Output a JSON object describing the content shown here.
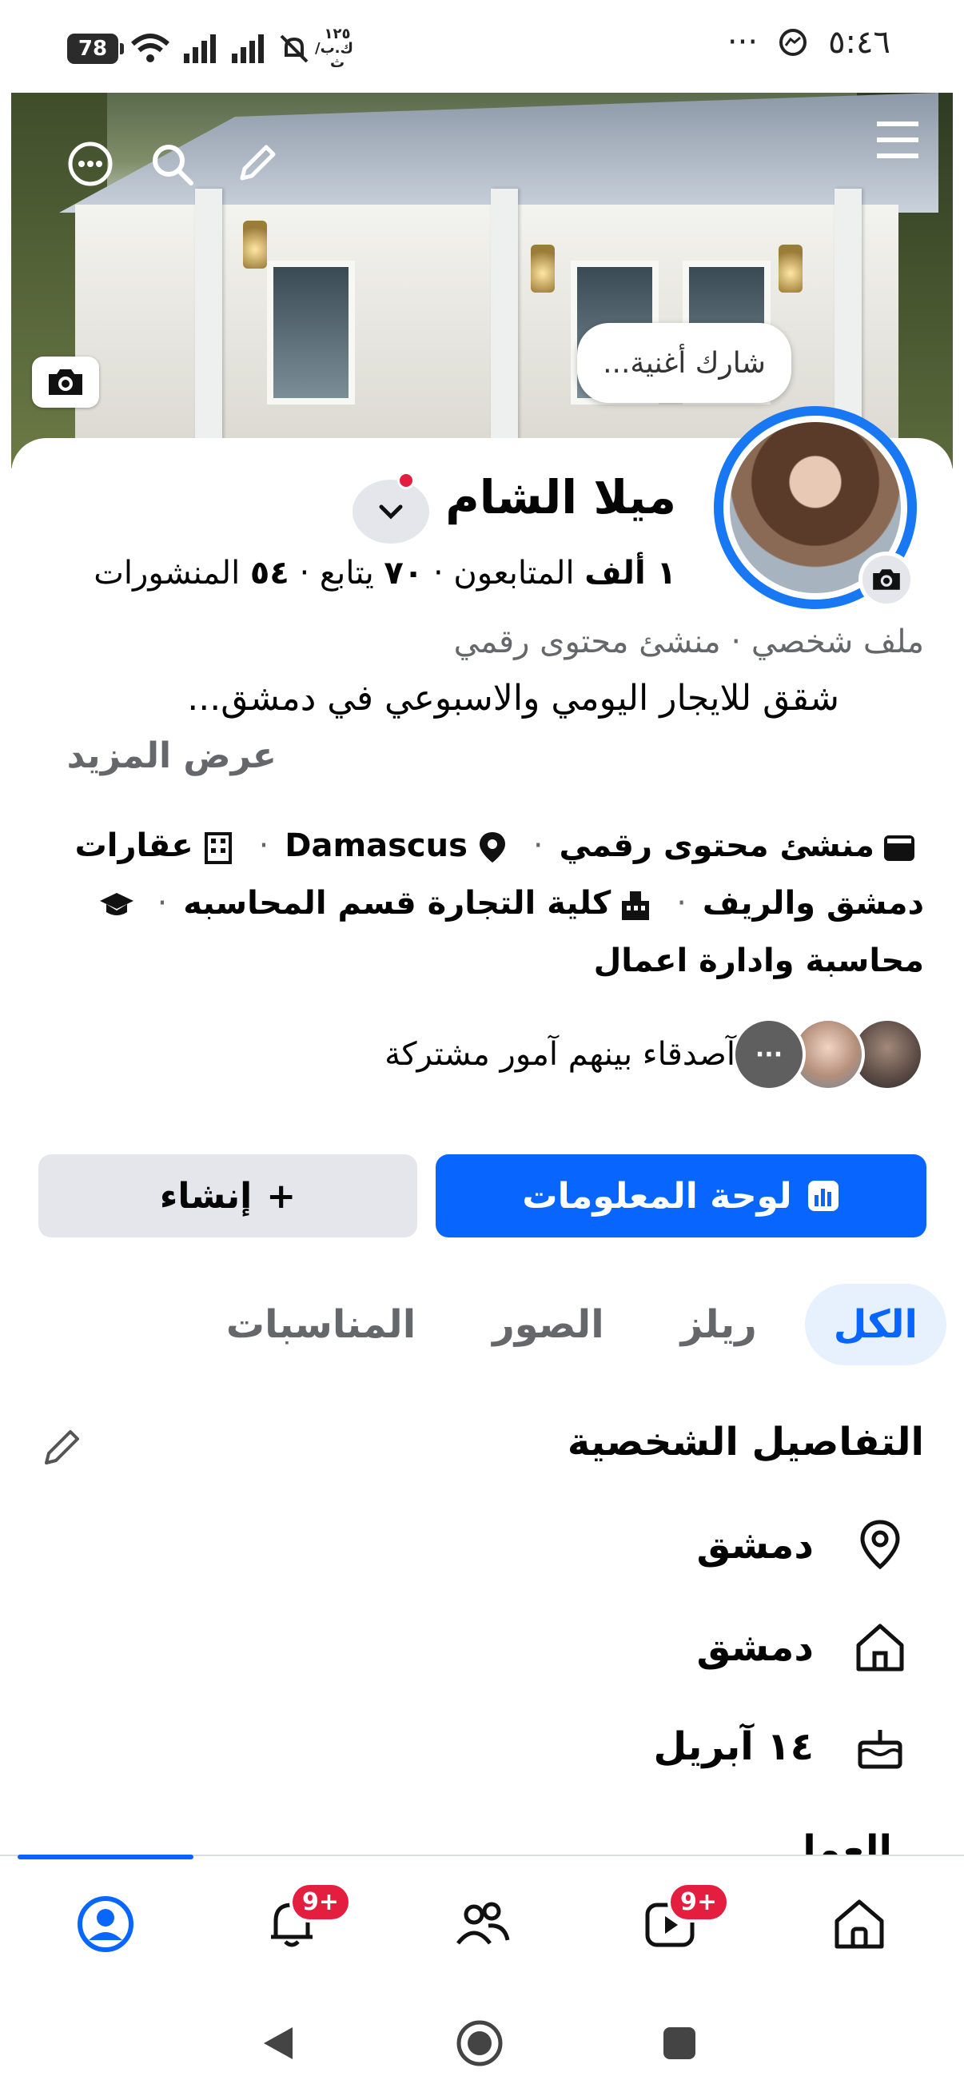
{
  "status_bar": {
    "time": "٥:٤٦",
    "dots": "···",
    "battery": "78",
    "network_speed": "١٢٥\nك.ب/ث"
  },
  "cover": {
    "song_prompt": "شارك أغنية..."
  },
  "profile": {
    "name": "ميلا الشام",
    "stats": {
      "followers_count": "١ ألف",
      "followers_label": "المتابعون",
      "following_count": "٧٠",
      "following_label": "يتابع",
      "posts_count": "٥٤",
      "posts_label": "المنشورات",
      "separator": "·"
    },
    "category": "ملف شخصي · منشئ محتوى رقمي",
    "bio": "شقق للايجار اليومي والاسبوعي في دمشق...",
    "see_more": "عرض المزيد",
    "details": {
      "creator": "منشئ محتوى رقمي",
      "city": "Damascus",
      "work": "عقارات دمشق والريف",
      "school": "كلية التجارة قسم المحاسبه",
      "study": "محاسبة وادارة اعمال"
    },
    "mutual_friends": "آصدقاء بينهم آمور مشتركة",
    "mutual_more": "···"
  },
  "actions": {
    "dashboard": "لوحة المعلومات",
    "create": "إنشاء",
    "create_prefix": "+"
  },
  "tabs": [
    {
      "label": "الكل",
      "active": true
    },
    {
      "label": "ريلز",
      "active": false
    },
    {
      "label": "الصور",
      "active": false
    },
    {
      "label": "المناسبات",
      "active": false
    }
  ],
  "personal_details": {
    "title": "التفاصيل الشخصية",
    "location": "دمشق",
    "hometown": "دمشق",
    "birthday": "١٤ آبريل",
    "next_section_partial": "العمل"
  },
  "bottom_nav": {
    "notifications_badge": "9+",
    "video_badge": "9+"
  },
  "colors": {
    "accent": "#0866ff",
    "badge": "#e41e3f",
    "secondary_text": "#65676b"
  }
}
